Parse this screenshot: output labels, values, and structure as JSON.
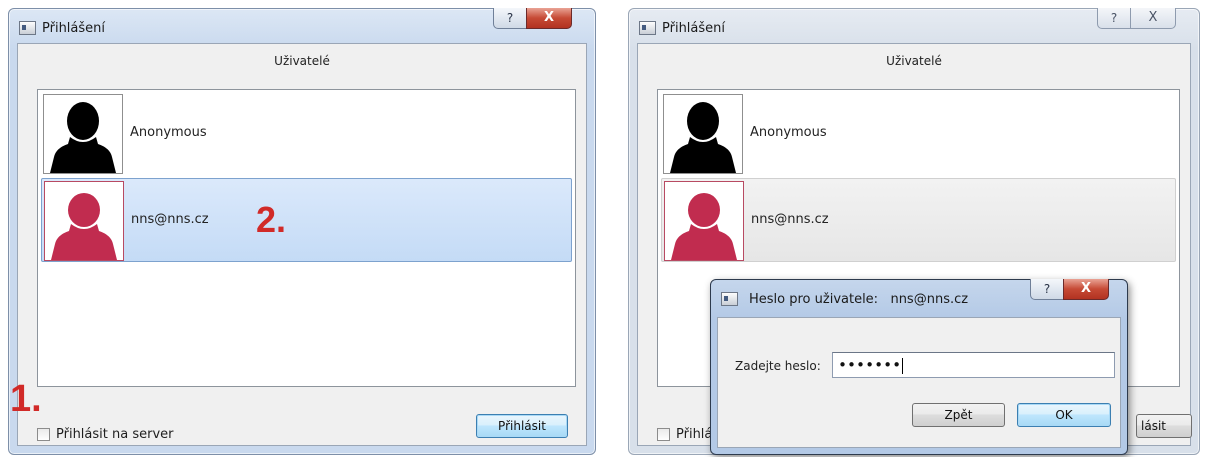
{
  "left_window": {
    "title": "Přihlášení",
    "help_glyph": "?",
    "close_glyph": "X",
    "heading": "Uživatelé",
    "users": [
      {
        "name": "Anonymous",
        "avatar_color": "#000000",
        "selected": false
      },
      {
        "name": "nns@nns.cz",
        "avatar_color": "#c12c4f",
        "selected": true
      }
    ],
    "checkbox_label": "Přihlásit na server",
    "checkbox_checked": false,
    "login_button": "Přihlásit",
    "annotation_1": "1.",
    "annotation_2": "2."
  },
  "right_window": {
    "title": "Přihlášení",
    "help_glyph": "?",
    "close_glyph": "X",
    "heading": "Uživatelé",
    "users": [
      {
        "name": "Anonymous",
        "avatar_color": "#000000",
        "selected": false
      },
      {
        "name": "nns@nns.cz",
        "avatar_color": "#c12c4f",
        "selected": true
      }
    ],
    "checkbox_label_partial": "Přihlá",
    "login_button_partial": "lásit"
  },
  "password_dialog": {
    "title": "Heslo pro uživatele:   nns@nns.cz",
    "help_glyph": "?",
    "close_glyph": "X",
    "label": "Zadejte heslo:",
    "masked_value": "•••••••",
    "back_button": "Zpět",
    "ok_button": "OK"
  },
  "colors": {
    "annotation": "#d12a28",
    "selection": "#c4dbf6",
    "avatar_red": "#c12c4f"
  }
}
